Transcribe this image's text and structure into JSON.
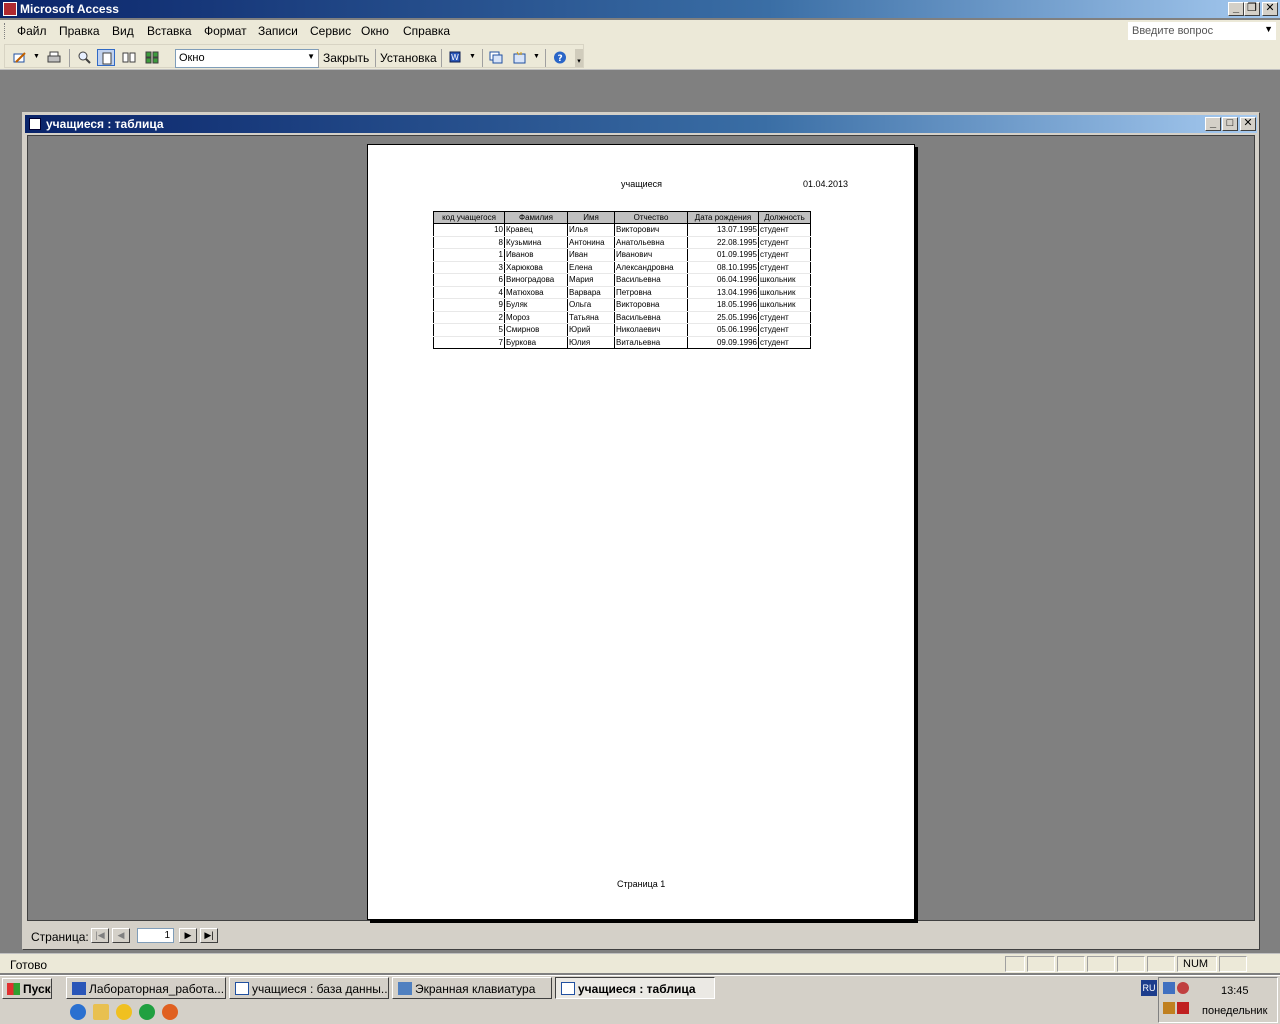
{
  "app": {
    "title": "Microsoft Access"
  },
  "menu": {
    "items": [
      "Файл",
      "Правка",
      "Вид",
      "Вставка",
      "Формат",
      "Записи",
      "Сервис",
      "Окно",
      "Справка"
    ],
    "help_placeholder": "Введите вопрос"
  },
  "toolbar": {
    "zoom_value": "Окно",
    "close_label": "Закрыть",
    "setup_label": "Установка"
  },
  "child_window": {
    "title": "учащиеся : таблица"
  },
  "report": {
    "header_title": "учащиеся",
    "header_date": "01.04.2013",
    "footer": "Страница 1",
    "columns": [
      "код учащегося",
      "Фамилия",
      "Имя",
      "Отчество",
      "Дата рождения",
      "Должность"
    ],
    "rows": [
      [
        "10",
        "Кравец",
        "Илья",
        "Викторович",
        "13.07.1995",
        "студент"
      ],
      [
        "8",
        "Кузьмина",
        "Антонина",
        "Анатольевна",
        "22.08.1995",
        "студент"
      ],
      [
        "1",
        "Иванов",
        "Иван",
        "Иванович",
        "01.09.1995",
        "студент"
      ],
      [
        "3",
        "Харюкова",
        "Елена",
        "Александровна",
        "08.10.1995",
        "студент"
      ],
      [
        "6",
        "Виноградова",
        "Мария",
        "Васильевна",
        "06.04.1996",
        "школьник"
      ],
      [
        "4",
        "Матюхова",
        "Варвара",
        "Петровна",
        "13.04.1996",
        "школьник"
      ],
      [
        "9",
        "Буляк",
        "Ольга",
        "Викторовна",
        "18.05.1996",
        "школьник"
      ],
      [
        "2",
        "Мороз",
        "Татьяна",
        "Васильевна",
        "25.05.1996",
        "студент"
      ],
      [
        "5",
        "Смирнов",
        "Юрий",
        "Николаевич",
        "05.06.1996",
        "студент"
      ],
      [
        "7",
        "Буркова",
        "Юлия",
        "Витальевна",
        "09.09.1996",
        "студент"
      ]
    ]
  },
  "navigation": {
    "label": "Страница:",
    "page_number": "1"
  },
  "status": {
    "text": "Готово",
    "num": "NUM"
  },
  "taskbar": {
    "start_label": "Пуск",
    "tasks": [
      {
        "label": "Лабораторная_работа..."
      },
      {
        "label": "учащиеся : база данны..."
      },
      {
        "label": "Экранная клавиатура"
      },
      {
        "label": "учащиеся : таблица"
      }
    ],
    "lang": "RU",
    "time": "13:45",
    "day": "понедельник"
  }
}
